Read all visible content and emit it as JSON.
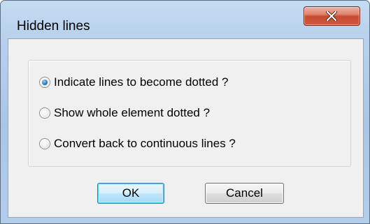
{
  "window": {
    "title": "Hidden lines"
  },
  "title_bar": {
    "close_icon": "close-x-icon"
  },
  "options": [
    {
      "label": "Indicate lines to become dotted ?",
      "selected": true
    },
    {
      "label": "Show whole element dotted ?",
      "selected": false
    },
    {
      "label": "Convert back to continuous lines ?",
      "selected": false
    }
  ],
  "buttons": {
    "ok_label": "OK",
    "cancel_label": "Cancel"
  },
  "colors": {
    "title_gradient": "#b7d1ec",
    "close_button": "#c74a30",
    "dialog_face": "#f0f0f0",
    "default_button_border": "#3c7fb1"
  }
}
